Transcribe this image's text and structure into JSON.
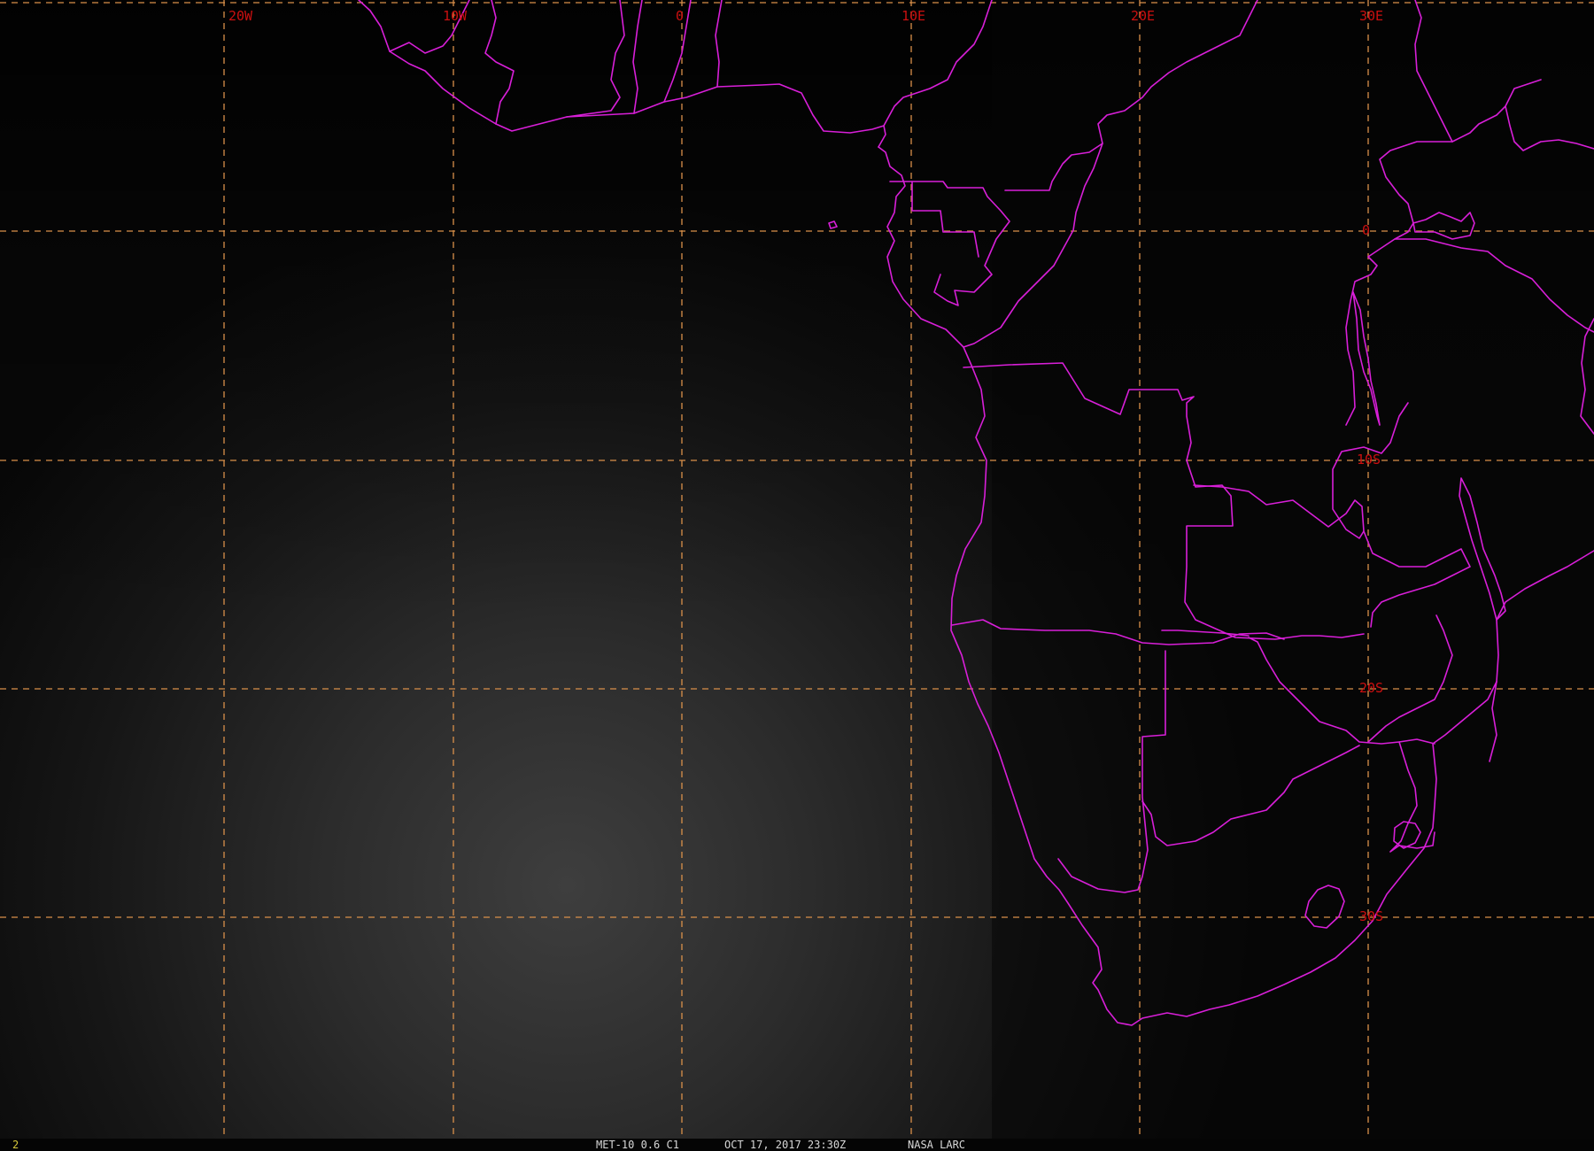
{
  "map": {
    "longitude_labels": [
      "20W",
      "10W",
      "0",
      "10E",
      "20E",
      "30E"
    ],
    "latitude_labels": [
      "0",
      "10S",
      "20S",
      "30S"
    ],
    "grid_color": "#d9904a",
    "label_color": "#cc1010",
    "boundary_color": "#d81fd8"
  },
  "footer": {
    "frame_number": "2",
    "satellite_channel": "MET-10 0.6 C1",
    "timestamp": "OCT 17, 2017 23:30Z",
    "credit": "NASA LARC"
  }
}
